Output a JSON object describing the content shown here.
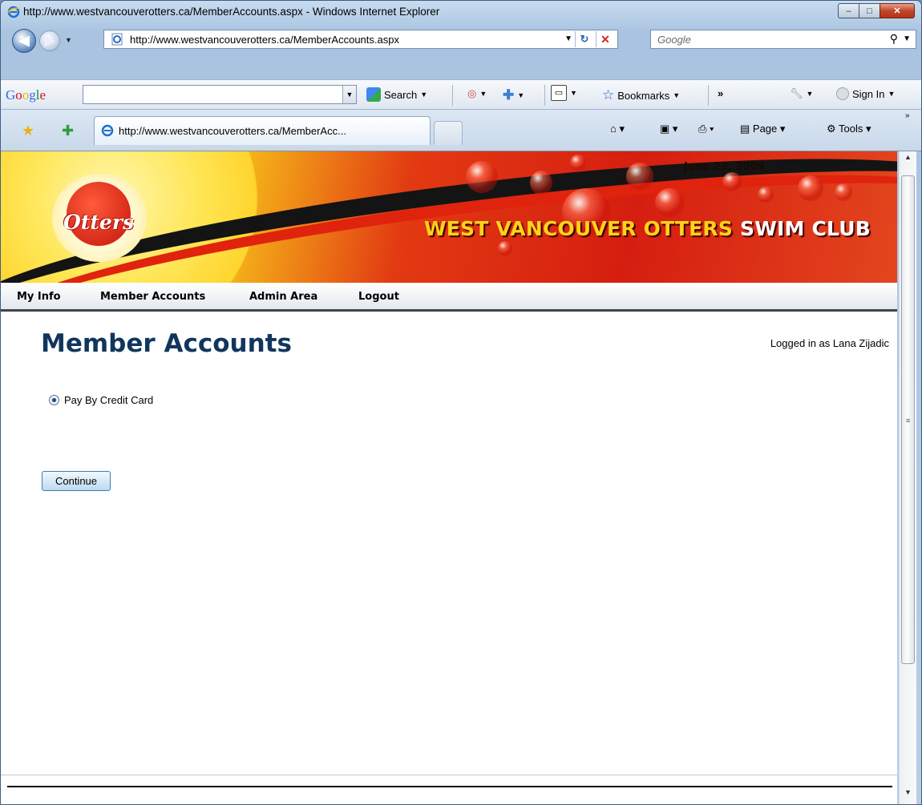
{
  "window": {
    "title": "http://www.westvancouverotters.ca/MemberAccounts.aspx - Windows Internet Explorer",
    "caption_buttons": {
      "minimize": "–",
      "maximize": "□",
      "close": "✕"
    }
  },
  "address_bar": {
    "url": "http://www.westvancouverotters.ca/MemberAccounts.aspx",
    "search_placeholder": "Google"
  },
  "google_toolbar": {
    "logo": "Google",
    "search_label": "Search",
    "bookmarks_label": "Bookmarks",
    "more": "»",
    "sign_in_label": "Sign In"
  },
  "tabs": {
    "active_tab_title": "http://www.westvancouverotters.ca/MemberAcc...",
    "page_menu": "Page",
    "tools_menu": "Tools"
  },
  "site": {
    "date": "June 23, 2009",
    "logo_text": "Otters",
    "club_name_part1": "WEST VANCOUVER OTTERS",
    "club_name_part2": "SWIM CLUB",
    "menu": [
      "My Info",
      "Member Accounts",
      "Admin Area",
      "Logout"
    ]
  },
  "page": {
    "heading": "Member Accounts",
    "logged_in": "Logged in as Lana Zijadic",
    "payment_option_label": "Pay By Credit Card",
    "payment_option_selected": true,
    "continue_label": "Continue"
  },
  "colors": {
    "heading": "#11365e",
    "banner_red": "#d51e10",
    "banner_yellow": "#ffd21a"
  }
}
